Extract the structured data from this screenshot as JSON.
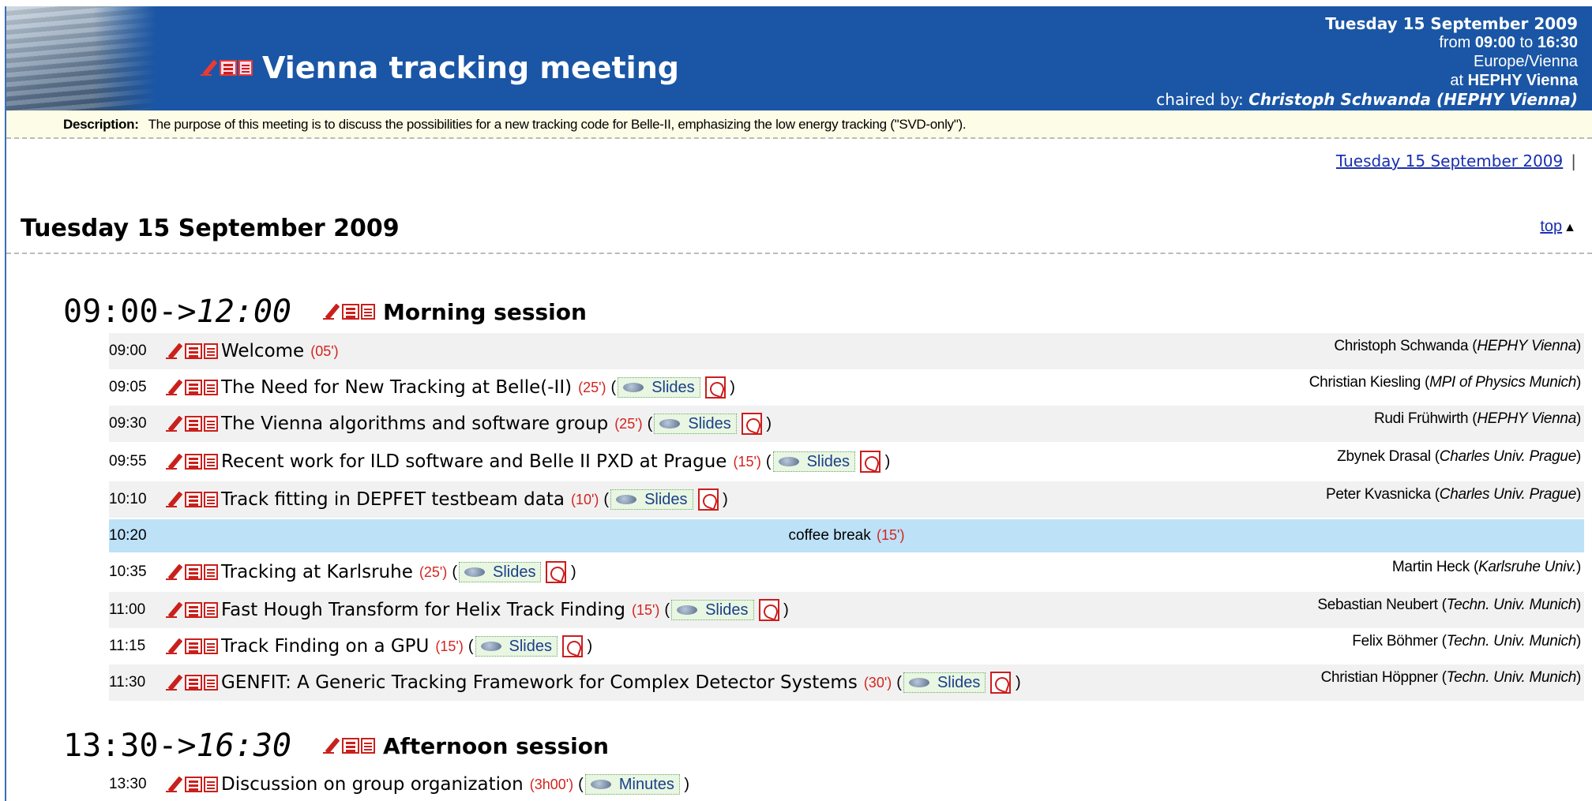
{
  "header": {
    "title": "Vienna tracking meeting",
    "date": "Tuesday 15 September 2009",
    "from_label": "from",
    "start_time": "09:00",
    "to_label": "to",
    "end_time": "16:30",
    "timezone": "Europe/Vienna",
    "at_label": "at",
    "location": "HEPHY Vienna",
    "chaired_label": "chaired by:",
    "chair": "Christoph Schwanda (HEPHY Vienna)"
  },
  "description": {
    "label": "Description:",
    "text": "The purpose of this meeting is to discuss the possibilities for a new tracking code for Belle-II, emphasizing the low energy tracking (\"SVD-only\")."
  },
  "day_link": "Tuesday 15 September 2009",
  "day_title": "Tuesday 15 September 2009",
  "top_link": "top",
  "sessions": [
    {
      "start": "09:00-",
      "arrow": ">",
      "end": "12:00",
      "title": "Morning session"
    },
    {
      "start": "13:30-",
      "arrow": ">",
      "end": "16:30",
      "title": "Afternoon session"
    }
  ],
  "contributions": [
    {
      "time": "09:00",
      "title": "Welcome",
      "duration": "(05')",
      "speaker": "Christoph Schwanda",
      "affiliation": "HEPHY Vienna"
    },
    {
      "time": "09:05",
      "title": "The Need for New Tracking at Belle(-II)",
      "duration": "(25')",
      "material": "Slides",
      "speaker": "Christian Kiesling",
      "affiliation": "MPI of Physics Munich"
    },
    {
      "time": "09:30",
      "title": "The Vienna algorithms and software group",
      "duration": "(25')",
      "material": "Slides",
      "speaker": "Rudi Frühwirth",
      "affiliation": "HEPHY Vienna"
    },
    {
      "time": "09:55",
      "title": "Recent work for ILD software and Belle II PXD at Prague",
      "duration": "(15')",
      "material": "Slides",
      "speaker": "Zbynek Drasal",
      "affiliation": "Charles Univ. Prague"
    },
    {
      "time": "10:10",
      "title": "Track fitting in DEPFET testbeam data",
      "duration": "(10')",
      "material": "Slides",
      "speaker": "Peter Kvasnicka",
      "affiliation": "Charles Univ. Prague"
    },
    {
      "time": "10:20",
      "break_label": "coffee break",
      "duration": "(15')"
    },
    {
      "time": "10:35",
      "title": "Tracking at Karlsruhe",
      "duration": "(25')",
      "material": "Slides",
      "speaker": "Martin Heck",
      "affiliation": "Karlsruhe Univ."
    },
    {
      "time": "11:00",
      "title": "Fast Hough Transform for Helix Track Finding",
      "duration": "(15')",
      "material": "Slides",
      "speaker": "Sebastian Neubert",
      "affiliation": "Techn. Univ. Munich"
    },
    {
      "time": "11:15",
      "title": "Track Finding on a GPU",
      "duration": "(15')",
      "material": "Slides",
      "speaker": "Felix Böhmer",
      "affiliation": "Techn. Univ. Munich"
    },
    {
      "time": "11:30",
      "title": "GENFIT: A Generic Tracking Framework for Complex Detector Systems",
      "duration": "(30')",
      "material": "Slides",
      "speaker": "Christian Höppner",
      "affiliation": "Techn. Univ. Munich"
    },
    {
      "time": "13:30",
      "title": "Discussion on group organization",
      "duration": "(3h00')",
      "material": "Minutes"
    }
  ],
  "colors": {
    "header_bg": "#1a56a5",
    "duration_red": "#d2241f",
    "break_bg": "#bde1f7",
    "link_blue": "#1a2fb0"
  }
}
